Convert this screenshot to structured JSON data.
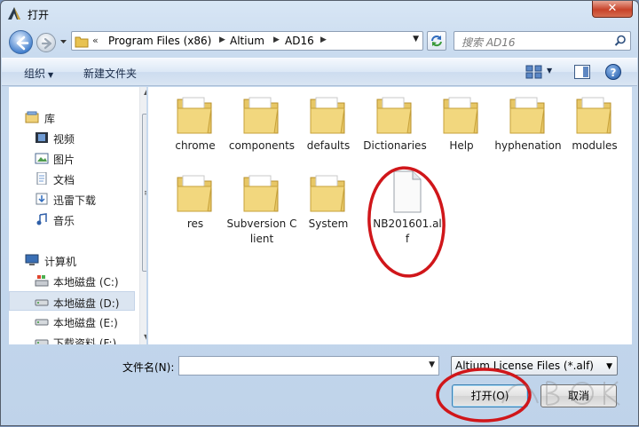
{
  "window": {
    "title": "打开",
    "close_label": "✕"
  },
  "address": {
    "chevron": "«",
    "crumbs": [
      "Program Files (x86)",
      "Altium",
      "AD16"
    ],
    "search_placeholder": "搜索 AD16"
  },
  "toolbar": {
    "organize_label": "组织",
    "new_folder_label": "新建文件夹",
    "help_label": "?"
  },
  "sidebar": {
    "items": [
      {
        "label": "库",
        "icon": "library-icon"
      },
      {
        "label": "视频",
        "icon": "video-icon"
      },
      {
        "label": "图片",
        "icon": "pictures-icon"
      },
      {
        "label": "文档",
        "icon": "documents-icon"
      },
      {
        "label": "迅雷下载",
        "icon": "download-icon"
      },
      {
        "label": "音乐",
        "icon": "music-icon"
      },
      {
        "label": "计算机",
        "icon": "computer-icon"
      },
      {
        "label": "本地磁盘 (C:)",
        "icon": "system-drive-icon"
      },
      {
        "label": "本地磁盘 (D:)",
        "icon": "drive-icon",
        "selected": true
      },
      {
        "label": "本地磁盘 (E:)",
        "icon": "drive-icon"
      },
      {
        "label": "下载资料 (F:)",
        "icon": "drive-icon"
      }
    ]
  },
  "files": [
    {
      "name": "chrome",
      "type": "folder"
    },
    {
      "name": "components",
      "type": "folder"
    },
    {
      "name": "defaults",
      "type": "folder"
    },
    {
      "name": "Dictionaries",
      "type": "folder"
    },
    {
      "name": "Help",
      "type": "folder"
    },
    {
      "name": "hyphenation",
      "type": "folder"
    },
    {
      "name": "modules",
      "type": "folder"
    },
    {
      "name": "res",
      "type": "folder"
    },
    {
      "name": "Subversion Client",
      "type": "folder"
    },
    {
      "name": "System",
      "type": "folder"
    },
    {
      "name": "NB201601.alf",
      "type": "file"
    }
  ],
  "bottom": {
    "filename_label": "文件名(N):",
    "filename_value": "",
    "filetype_value": "Altium License Files (*.alf)",
    "open_label": "打开(O)",
    "cancel_label": "取消"
  },
  "colors": {
    "annotation": "#d0161a",
    "selection": "#dbe5f1"
  }
}
